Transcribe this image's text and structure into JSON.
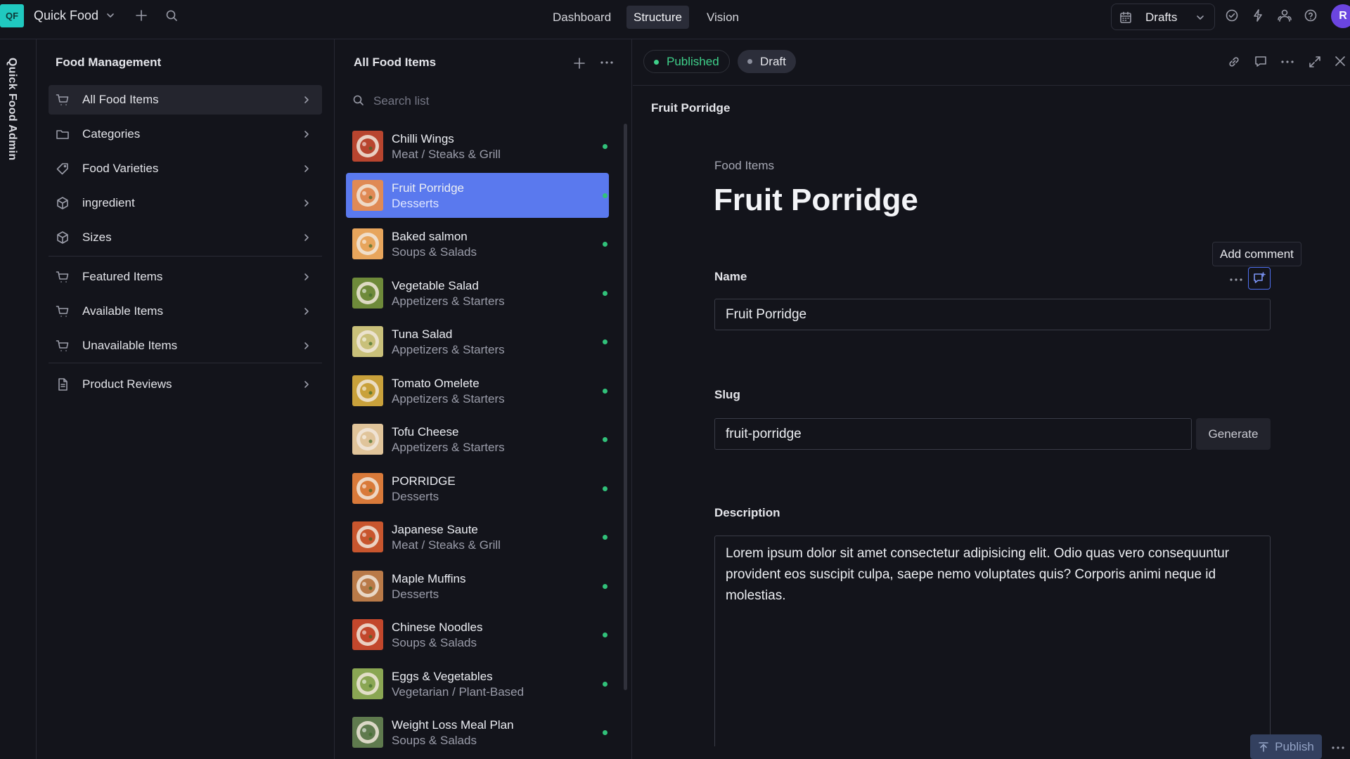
{
  "topbar": {
    "logo": "QF",
    "app_title": "Quick Food",
    "nav": [
      "Dashboard",
      "Structure",
      "Vision"
    ],
    "active_nav": "Structure",
    "drafts_label": "Drafts",
    "avatar": "R"
  },
  "sidebar_strip": {
    "label": "Quick Food Admin"
  },
  "food_management": {
    "title": "Food Management",
    "items": [
      {
        "label": "All Food Items",
        "icon": "cart-icon",
        "active": true
      },
      {
        "label": "Categories",
        "icon": "folder-icon"
      },
      {
        "label": "Food Varieties",
        "icon": "tag-icon"
      },
      {
        "label": "ingredient",
        "icon": "cube-icon"
      },
      {
        "label": "Sizes",
        "icon": "cube-icon"
      },
      {
        "label": "Featured Items",
        "icon": "cart-icon"
      },
      {
        "label": "Available Items",
        "icon": "cart-icon"
      },
      {
        "label": "Unavailable Items",
        "icon": "cart-icon"
      },
      {
        "label": "Product Reviews",
        "icon": "document-icon"
      }
    ]
  },
  "food_list": {
    "title": "All Food Items",
    "search_placeholder": "Search list",
    "selected_index": 1,
    "items": [
      {
        "title": "Chilli Wings",
        "subtitle": "Meat / Steaks & Grill",
        "thumb": "#b8452f"
      },
      {
        "title": "Fruit Porridge",
        "subtitle": "Desserts",
        "thumb": "#e08a55"
      },
      {
        "title": "Baked salmon",
        "subtitle": "Soups & Salads",
        "thumb": "#e7a55c"
      },
      {
        "title": "Vegetable Salad",
        "subtitle": "Appetizers & Starters",
        "thumb": "#6e8a3a"
      },
      {
        "title": "Tuna Salad",
        "subtitle": "Appetizers & Starters",
        "thumb": "#c9c07a"
      },
      {
        "title": "Tomato Omelete",
        "subtitle": "Appetizers & Starters",
        "thumb": "#c9a13b"
      },
      {
        "title": "Tofu Cheese",
        "subtitle": "Appetizers & Starters",
        "thumb": "#e0c49a"
      },
      {
        "title": "PORRIDGE",
        "subtitle": "Desserts",
        "thumb": "#d97a3a"
      },
      {
        "title": "Japanese Saute",
        "subtitle": "Meat / Steaks & Grill",
        "thumb": "#c8562e"
      },
      {
        "title": "Maple Muffins",
        "subtitle": "Desserts",
        "thumb": "#b97a48"
      },
      {
        "title": "Chinese Noodles",
        "subtitle": "Soups & Salads",
        "thumb": "#c2472c"
      },
      {
        "title": "Eggs & Vegetables",
        "subtitle": "Vegetarian / Plant-Based",
        "thumb": "#8aa653"
      },
      {
        "title": "Weight Loss Meal Plan",
        "subtitle": "Soups & Salads",
        "thumb": "#5f7a4e"
      }
    ]
  },
  "document": {
    "status_published": "Published",
    "status_draft": "Draft",
    "breadcrumb": "Fruit Porridge",
    "type": "Food Items",
    "title": "Fruit Porridge",
    "tooltip": "Add comment",
    "fields": {
      "name_label": "Name",
      "name_value": "Fruit Porridge",
      "slug_label": "Slug",
      "slug_value": "fruit-porridge",
      "generate_label": "Generate",
      "description_label": "Description",
      "description_value": "Lorem ipsum dolor sit amet consectetur adipisicing elit. Odio quas vero consequuntur provident eos suscipit culpa, saepe nemo voluptates quis? Corporis animi neque id molestias."
    },
    "publish_label": "Publish"
  },
  "colors": {
    "accent": "#5a79ee",
    "published": "#3fd08a",
    "logo": "#20c9c0",
    "avatar": "#6b45e0"
  }
}
